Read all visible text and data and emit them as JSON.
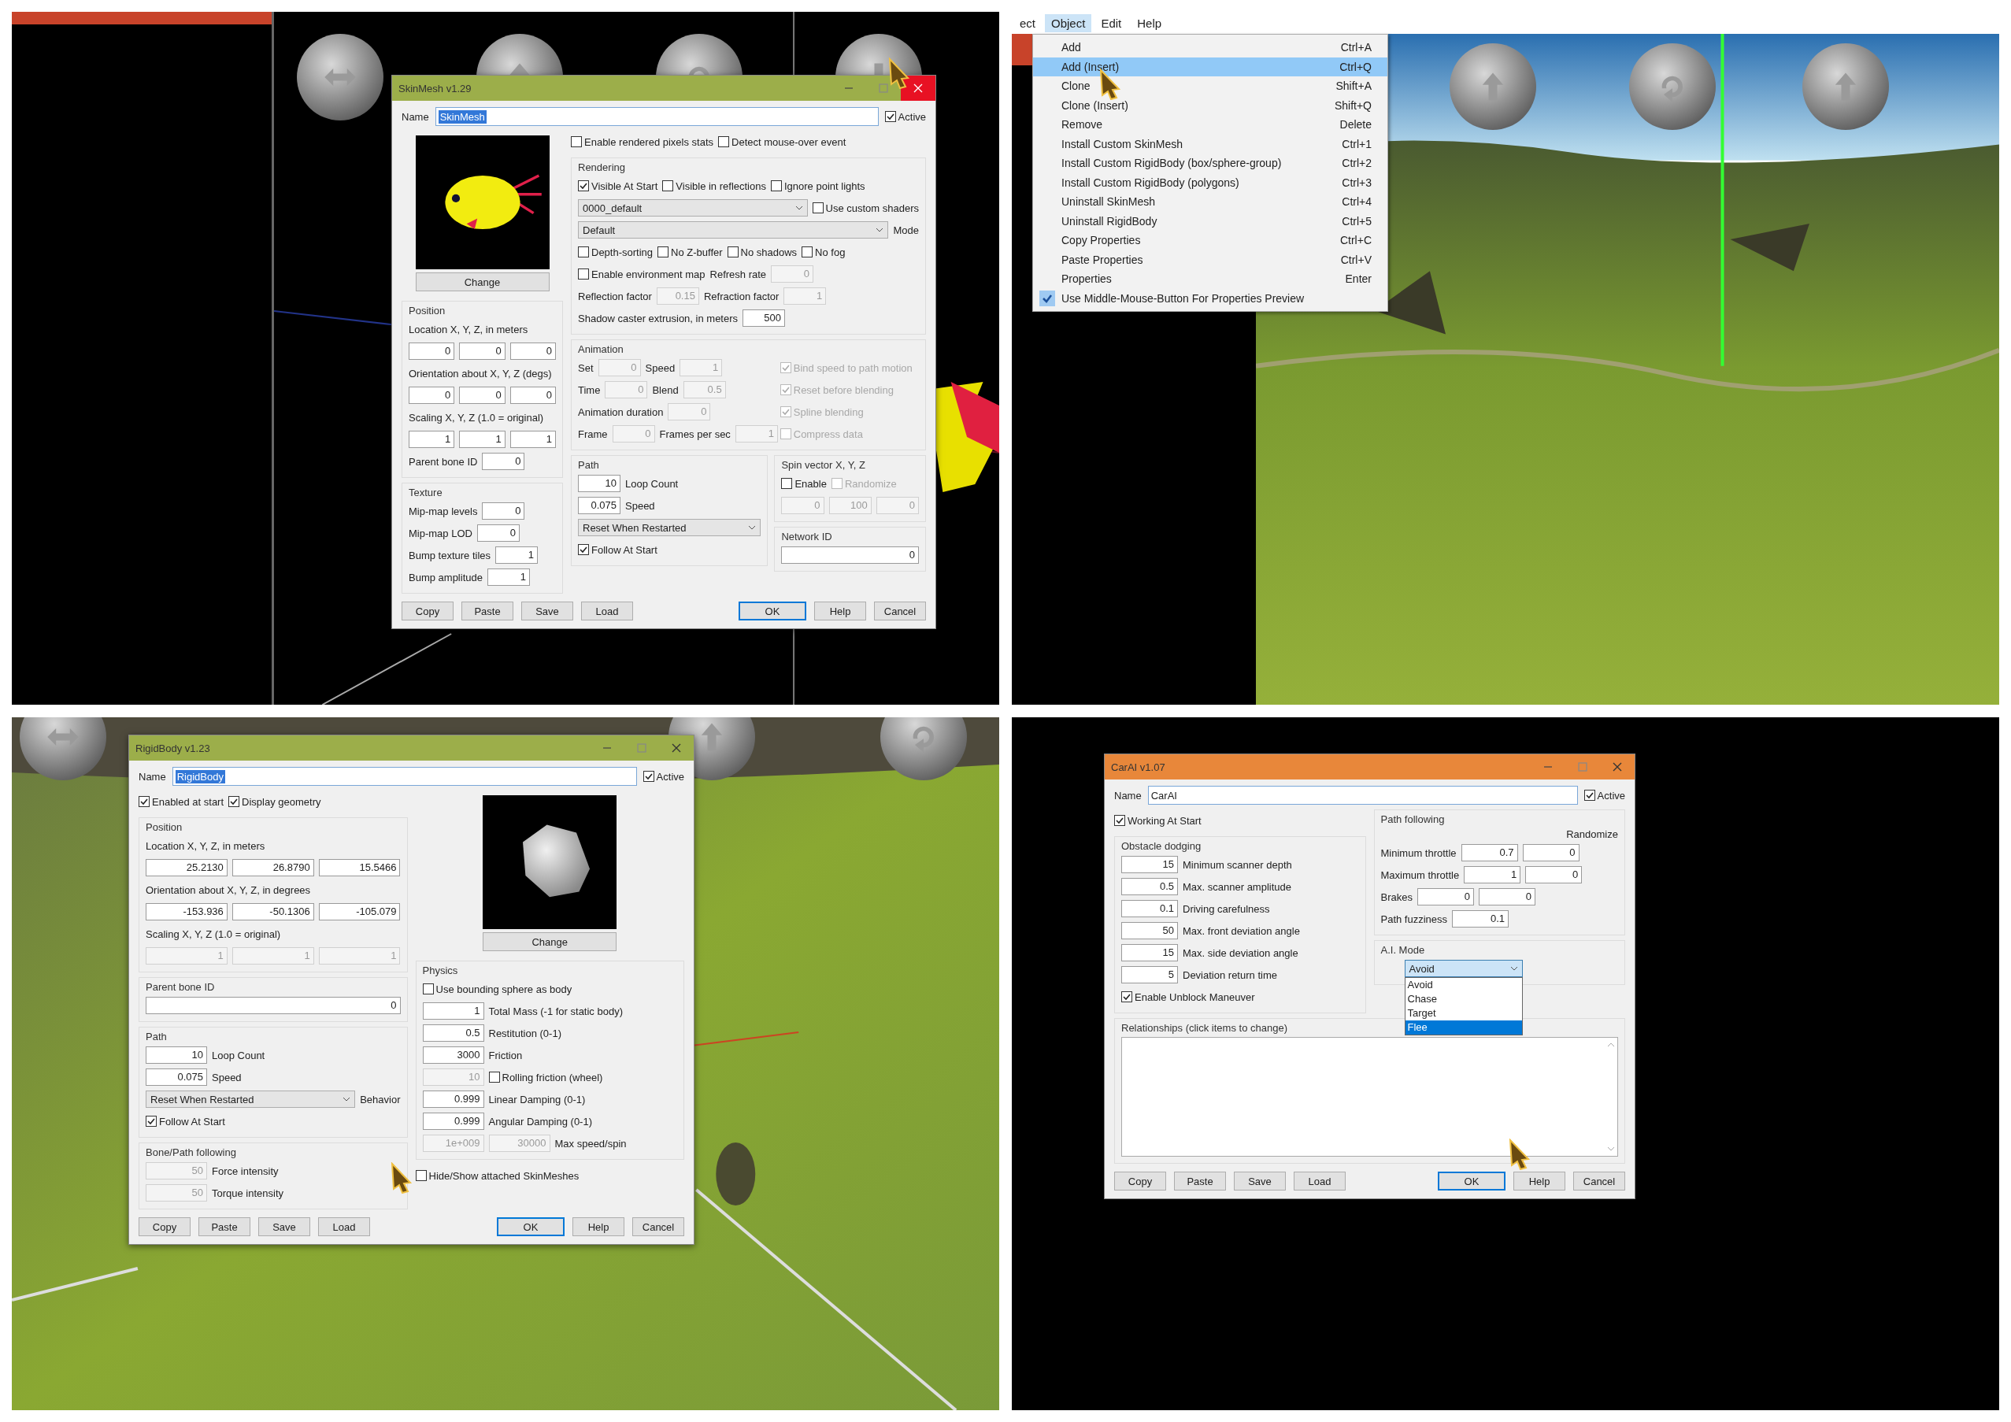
{
  "panels": [
    {
      "kind": "viewport",
      "spheres": [
        {
          "kind": "left-right"
        },
        {
          "kind": "up"
        },
        {
          "kind": "rotate"
        },
        {
          "kind": "down"
        }
      ],
      "dialog": {
        "title": "SkinMesh v1.29",
        "color": "#9cae4a",
        "close_hovered": true,
        "name_label": "Name",
        "name": "SkinMesh",
        "name_selected": true,
        "active": {
          "label": "Active",
          "checked": true
        },
        "body": [
          {
            "columns": [
              [
                {
                  "kind": "creature-preview",
                  "button": "Change"
                },
                {
                  "kind": "group",
                  "title": "Position",
                  "rows": [
                    [
                      {
                        "kind": "text",
                        "label": "Location X, Y, Z, in meters"
                      }
                    ],
                    [
                      {
                        "kind": "field",
                        "value": "0",
                        "disabled": false
                      },
                      {
                        "kind": "field",
                        "value": "0",
                        "disabled": false
                      },
                      {
                        "kind": "field",
                        "value": "0",
                        "disabled": false
                      }
                    ],
                    [
                      {
                        "kind": "text",
                        "label": "Orientation about X, Y, Z (degs)"
                      }
                    ],
                    [
                      {
                        "kind": "field",
                        "value": "0",
                        "disabled": false
                      },
                      {
                        "kind": "field",
                        "value": "0",
                        "disabled": false
                      },
                      {
                        "kind": "field",
                        "value": "0",
                        "disabled": false
                      }
                    ],
                    [
                      {
                        "kind": "text",
                        "label": "Scaling X, Y, Z (1.0 = original)"
                      }
                    ],
                    [
                      {
                        "kind": "field",
                        "value": "1",
                        "disabled": false
                      },
                      {
                        "kind": "field",
                        "value": "1",
                        "disabled": false
                      },
                      {
                        "kind": "field",
                        "value": "1",
                        "disabled": false
                      }
                    ],
                    [
                      {
                        "kind": "text",
                        "label": "Parent bone ID"
                      },
                      {
                        "kind": "field",
                        "value": "0",
                        "disabled": false
                      }
                    ]
                  ]
                },
                {
                  "kind": "group",
                  "title": "Texture",
                  "rows": [
                    [
                      {
                        "kind": "text",
                        "label": "Mip-map levels"
                      },
                      {
                        "kind": "field",
                        "value": "0",
                        "disabled": false
                      }
                    ],
                    [
                      {
                        "kind": "text",
                        "label": "Mip-map LOD"
                      },
                      {
                        "kind": "field",
                        "value": "0",
                        "disabled": false
                      }
                    ],
                    [
                      {
                        "kind": "text",
                        "label": "Bump texture tiles"
                      },
                      {
                        "kind": "field",
                        "value": "1",
                        "disabled": false
                      }
                    ],
                    [
                      {
                        "kind": "text",
                        "label": "Bump amplitude"
                      },
                      {
                        "kind": "field",
                        "value": "1",
                        "disabled": false
                      }
                    ]
                  ]
                }
              ],
              [
                {
                  "kind": "plain",
                  "rows": [
                    [
                      {
                        "kind": "check",
                        "label": "Enable rendered pixels stats",
                        "checked": false,
                        "disabled": false
                      },
                      {
                        "kind": "check",
                        "label": "Detect mouse-over event",
                        "checked": false,
                        "disabled": false
                      }
                    ]
                  ]
                },
                {
                  "kind": "group",
                  "title": "Rendering",
                  "rows": [
                    [
                      {
                        "kind": "check",
                        "label": "Visible At Start",
                        "checked": true,
                        "disabled": false
                      },
                      {
                        "kind": "check",
                        "label": "Visible in reflections",
                        "checked": false,
                        "disabled": false
                      },
                      {
                        "kind": "check",
                        "label": "Ignore point lights",
                        "checked": false,
                        "disabled": false
                      }
                    ],
                    [
                      {
                        "kind": "select",
                        "value": "0000_default"
                      },
                      {
                        "kind": "check",
                        "label": "Use custom shaders",
                        "checked": false,
                        "disabled": false
                      }
                    ],
                    [
                      {
                        "kind": "select",
                        "value": "Default"
                      },
                      {
                        "kind": "text",
                        "label": "Mode"
                      }
                    ],
                    [
                      {
                        "kind": "check",
                        "label": "Depth-sorting",
                        "checked": false,
                        "disabled": false
                      },
                      {
                        "kind": "check",
                        "label": "No Z-buffer",
                        "checked": false,
                        "disabled": false
                      },
                      {
                        "kind": "check",
                        "label": "No shadows",
                        "checked": false,
                        "disabled": false
                      },
                      {
                        "kind": "check",
                        "label": "No fog",
                        "checked": false,
                        "disabled": false
                      }
                    ],
                    [
                      {
                        "kind": "check",
                        "label": "Enable environment map",
                        "checked": false,
                        "disabled": false
                      },
                      {
                        "kind": "text",
                        "label": "Refresh rate"
                      },
                      {
                        "kind": "field",
                        "value": "0",
                        "disabled": true
                      }
                    ],
                    [
                      {
                        "kind": "text",
                        "label": "Reflection factor"
                      },
                      {
                        "kind": "field",
                        "value": "0.15",
                        "disabled": true
                      },
                      {
                        "kind": "text",
                        "label": "Refraction factor"
                      },
                      {
                        "kind": "field",
                        "value": "1",
                        "disabled": true
                      }
                    ],
                    [
                      {
                        "kind": "text",
                        "label": "Shadow caster extrusion, in meters"
                      },
                      {
                        "kind": "field",
                        "value": "500",
                        "disabled": false
                      }
                    ]
                  ]
                },
                {
                  "kind": "group",
                  "title": "Animation",
                  "rows": [
                    [
                      {
                        "kind": "text",
                        "label": "Set"
                      },
                      {
                        "kind": "field",
                        "value": "0",
                        "disabled": true
                      },
                      {
                        "kind": "text",
                        "label": "Speed"
                      },
                      {
                        "kind": "field",
                        "value": "1",
                        "disabled": true
                      }
                    ],
                    [
                      {
                        "kind": "text",
                        "label": "Time"
                      },
                      {
                        "kind": "field",
                        "value": "0",
                        "disabled": true
                      },
                      {
                        "kind": "text",
                        "label": "Blend"
                      },
                      {
                        "kind": "field",
                        "value": "0.5",
                        "disabled": true
                      }
                    ],
                    [
                      {
                        "kind": "text",
                        "label": "Animation duration"
                      },
                      {
                        "kind": "field",
                        "value": "0",
                        "disabled": true
                      }
                    ],
                    [
                      {
                        "kind": "text",
                        "label": "Frame"
                      },
                      {
                        "kind": "field",
                        "value": "0",
                        "disabled": true
                      },
                      {
                        "kind": "text",
                        "label": "Frames per sec"
                      },
                      {
                        "kind": "field",
                        "value": "1",
                        "disabled": true
                      }
                    ]
                  ],
                  "aside": [
                    [
                      {
                        "kind": "check",
                        "label": "Bind speed to path motion",
                        "checked": true,
                        "disabled": true
                      }
                    ],
                    [
                      {
                        "kind": "check",
                        "label": "Reset before blending",
                        "checked": true,
                        "disabled": true
                      }
                    ],
                    [
                      {
                        "kind": "check",
                        "label": "Spline blending",
                        "checked": true,
                        "disabled": true
                      }
                    ],
                    [
                      {
                        "kind": "check",
                        "label": "Compress data",
                        "checked": false,
                        "disabled": true
                      }
                    ]
                  ]
                },
                {
                  "kind": "pair",
                  "stacks": [
                    [
                      {
                        "kind": "group",
                        "title": "Path",
                        "rows": [
                          [
                            {
                              "kind": "field",
                              "value": "10",
                              "disabled": false
                            },
                            {
                              "kind": "text",
                              "label": "Loop Count"
                            }
                          ],
                          [
                            {
                              "kind": "field",
                              "value": "0.075",
                              "disabled": false
                            },
                            {
                              "kind": "text",
                              "label": "Speed"
                            }
                          ],
                          [
                            {
                              "kind": "select",
                              "value": "Reset When Restarted"
                            }
                          ],
                          [
                            {
                              "kind": "check",
                              "label": "Follow At Start",
                              "checked": true,
                              "disabled": false
                            }
                          ]
                        ]
                      }
                    ],
                    [
                      {
                        "kind": "group",
                        "title": "Spin vector X, Y, Z",
                        "rows": [
                          [
                            {
                              "kind": "check",
                              "label": "Enable",
                              "checked": false,
                              "disabled": false
                            },
                            {
                              "kind": "check",
                              "label": "Randomize",
                              "checked": false,
                              "disabled": true
                            }
                          ],
                          [
                            {
                              "kind": "field",
                              "value": "0",
                              "disabled": true
                            },
                            {
                              "kind": "field",
                              "value": "100",
                              "disabled": true
                            },
                            {
                              "kind": "field",
                              "value": "0",
                              "disabled": true
                            }
                          ]
                        ]
                      },
                      {
                        "kind": "group",
                        "title": "Network ID",
                        "rows": [
                          [
                            {
                              "kind": "field",
                              "value": "0",
                              "disabled": false
                            }
                          ]
                        ]
                      }
                    ]
                  ]
                }
              ]
            ]
          }
        ],
        "buttons": [
          {
            "label": "Copy",
            "default": false
          },
          {
            "label": "Paste",
            "default": false
          },
          {
            "label": "Save",
            "default": false
          },
          {
            "label": "Load",
            "default": false
          },
          {
            "label": "OK",
            "default": true
          },
          {
            "label": "Help",
            "default": false
          },
          {
            "label": "Cancel",
            "default": false
          }
        ]
      }
    },
    {
      "kind": "menu",
      "spheres": [
        {
          "kind": "up"
        },
        {
          "kind": "rotate"
        },
        {
          "kind": "up"
        }
      ],
      "menubar": [
        {
          "label": "ect",
          "selected": false
        },
        {
          "label": "Object",
          "selected": true
        },
        {
          "label": "Edit",
          "selected": false
        },
        {
          "label": "Help",
          "selected": false
        }
      ],
      "menu": [
        {
          "label": "Add",
          "shortcut": "Ctrl+A",
          "highlighted": false,
          "checked": false
        },
        {
          "label": "Add (Insert)",
          "shortcut": "Ctrl+Q",
          "highlighted": true,
          "checked": false
        },
        {
          "label": "Clone",
          "shortcut": "Shift+A",
          "highlighted": false,
          "checked": false
        },
        {
          "label": "Clone (Insert)",
          "shortcut": "Shift+Q",
          "highlighted": false,
          "checked": false
        },
        {
          "label": "Remove",
          "shortcut": "Delete",
          "highlighted": false,
          "checked": false
        },
        {
          "label": "Install Custom SkinMesh",
          "shortcut": "Ctrl+1",
          "highlighted": false,
          "checked": false
        },
        {
          "label": "Install Custom RigidBody (box/sphere-group)",
          "shortcut": "Ctrl+2",
          "highlighted": false,
          "checked": false
        },
        {
          "label": "Install Custom RigidBody (polygons)",
          "shortcut": "Ctrl+3",
          "highlighted": false,
          "checked": false
        },
        {
          "label": "Uninstall SkinMesh",
          "shortcut": "Ctrl+4",
          "highlighted": false,
          "checked": false
        },
        {
          "label": "Uninstall RigidBody",
          "shortcut": "Ctrl+5",
          "highlighted": false,
          "checked": false
        },
        {
          "label": "Copy Properties",
          "shortcut": "Ctrl+C",
          "highlighted": false,
          "checked": false
        },
        {
          "label": "Paste Properties",
          "shortcut": "Ctrl+V",
          "highlighted": false,
          "checked": false
        },
        {
          "label": "Properties",
          "shortcut": "Enter",
          "highlighted": false,
          "checked": false
        },
        {
          "label": "Use Middle-Mouse-Button For Properties Preview",
          "highlighted": false,
          "checked": true
        }
      ]
    },
    {
      "kind": "terrain",
      "spheres": [
        {
          "kind": "left-right"
        },
        {
          "kind": "up"
        },
        {
          "kind": "rotate"
        }
      ],
      "dialog": {
        "title": "RigidBody v1.23",
        "color": "#9cae4a",
        "close_hovered": false,
        "name_label": "Name",
        "name": "RigidBody",
        "name_selected": true,
        "active": {
          "label": "Active",
          "checked": true
        },
        "body": [
          {
            "columns": [
              [
                {
                  "kind": "plain",
                  "rows": [
                    [
                      {
                        "kind": "check",
                        "label": "Enabled at start",
                        "checked": true,
                        "disabled": false
                      },
                      {
                        "kind": "check",
                        "label": "Display geometry",
                        "checked": true,
                        "disabled": false
                      }
                    ]
                  ]
                },
                {
                  "kind": "group",
                  "title": "Position",
                  "rows": [
                    [
                      {
                        "kind": "text",
                        "label": "Location X, Y, Z, in meters"
                      }
                    ],
                    [
                      {
                        "kind": "field",
                        "value": "25.2130",
                        "disabled": false
                      },
                      {
                        "kind": "field",
                        "value": "26.8790",
                        "disabled": false
                      },
                      {
                        "kind": "field",
                        "value": "15.5466",
                        "disabled": false
                      }
                    ],
                    [
                      {
                        "kind": "text",
                        "label": "Orientation about X, Y, Z, in degrees"
                      }
                    ],
                    [
                      {
                        "kind": "field",
                        "value": "-153.936",
                        "disabled": false
                      },
                      {
                        "kind": "field",
                        "value": "-50.1306",
                        "disabled": false
                      },
                      {
                        "kind": "field",
                        "value": "-105.079",
                        "disabled": false
                      }
                    ],
                    [
                      {
                        "kind": "text",
                        "label": "Scaling X, Y, Z (1.0 = original)"
                      }
                    ],
                    [
                      {
                        "kind": "field",
                        "value": "1",
                        "disabled": true
                      },
                      {
                        "kind": "field",
                        "value": "1",
                        "disabled": true
                      },
                      {
                        "kind": "field",
                        "value": "1",
                        "disabled": true
                      }
                    ]
                  ]
                },
                {
                  "kind": "group",
                  "title": "Parent bone ID",
                  "rows": [
                    [
                      {
                        "kind": "field",
                        "value": "0",
                        "disabled": false
                      }
                    ]
                  ]
                },
                {
                  "kind": "group",
                  "title": "Path",
                  "rows": [
                    [
                      {
                        "kind": "field",
                        "value": "10",
                        "disabled": false
                      },
                      {
                        "kind": "text",
                        "label": "Loop Count"
                      }
                    ],
                    [
                      {
                        "kind": "field",
                        "value": "0.075",
                        "disabled": false
                      },
                      {
                        "kind": "text",
                        "label": "Speed"
                      }
                    ],
                    [
                      {
                        "kind": "select",
                        "value": "Reset When Restarted"
                      },
                      {
                        "kind": "text",
                        "label": "Behavior"
                      }
                    ],
                    [
                      {
                        "kind": "check",
                        "label": "Follow At Start",
                        "checked": true,
                        "disabled": false
                      }
                    ]
                  ]
                },
                {
                  "kind": "group",
                  "title": "Bone/Path following",
                  "rows": [
                    [
                      {
                        "kind": "field",
                        "value": "50",
                        "disabled": true
                      },
                      {
                        "kind": "text",
                        "label": "Force intensity"
                      }
                    ],
                    [
                      {
                        "kind": "field",
                        "value": "50",
                        "disabled": true
                      },
                      {
                        "kind": "text",
                        "label": "Torque intensity"
                      }
                    ]
                  ]
                }
              ],
              [
                {
                  "kind": "rock-preview",
                  "button": "Change"
                },
                {
                  "kind": "group",
                  "title": "Physics",
                  "rows": [
                    [
                      {
                        "kind": "check",
                        "label": "Use bounding sphere as body",
                        "checked": false,
                        "disabled": false
                      }
                    ],
                    [
                      {
                        "kind": "field",
                        "value": "1",
                        "disabled": false
                      },
                      {
                        "kind": "text",
                        "label": "Total Mass (-1 for static body)"
                      }
                    ],
                    [
                      {
                        "kind": "field",
                        "value": "0.5",
                        "disabled": false
                      },
                      {
                        "kind": "text",
                        "label": "Restitution (0-1)"
                      }
                    ],
                    [
                      {
                        "kind": "field",
                        "value": "3000",
                        "disabled": false
                      },
                      {
                        "kind": "text",
                        "label": "Friction"
                      }
                    ],
                    [
                      {
                        "kind": "field",
                        "value": "10",
                        "disabled": true
                      },
                      {
                        "kind": "check",
                        "label": "Rolling friction (wheel)",
                        "checked": false,
                        "disabled": false
                      }
                    ],
                    [
                      {
                        "kind": "field",
                        "value": "0.999",
                        "disabled": false
                      },
                      {
                        "kind": "text",
                        "label": "Linear Damping (0-1)"
                      }
                    ],
                    [
                      {
                        "kind": "field",
                        "value": "0.999",
                        "disabled": false
                      },
                      {
                        "kind": "text",
                        "label": "Angular Damping (0-1)"
                      }
                    ],
                    [
                      {
                        "kind": "field",
                        "value": "1e+009",
                        "disabled": true
                      },
                      {
                        "kind": "field",
                        "value": "30000",
                        "disabled": true
                      },
                      {
                        "kind": "text",
                        "label": "Max speed/spin"
                      }
                    ]
                  ]
                },
                {
                  "kind": "plain",
                  "rows": [
                    [
                      {
                        "kind": "check",
                        "label": "Hide/Show attached SkinMeshes",
                        "checked": false,
                        "disabled": false
                      }
                    ]
                  ]
                }
              ]
            ]
          }
        ],
        "buttons": [
          {
            "label": "Copy",
            "default": false
          },
          {
            "label": "Paste",
            "default": false
          },
          {
            "label": "Save",
            "default": false
          },
          {
            "label": "Load",
            "default": false
          },
          {
            "label": "OK",
            "default": true
          },
          {
            "label": "Help",
            "default": false
          },
          {
            "label": "Cancel",
            "default": false
          }
        ]
      }
    },
    {
      "kind": "dark",
      "dialog": {
        "title": "CarAI v1.07",
        "color": "#e8873a",
        "close_hovered": false,
        "name_label": "Name",
        "name": "CarAI",
        "name_selected": false,
        "active": {
          "label": "Active",
          "checked": true
        },
        "body": [
          {
            "columns": [
              [
                {
                  "kind": "plain",
                  "rows": [
                    [
                      {
                        "kind": "check",
                        "label": "Working At Start",
                        "checked": true,
                        "disabled": false
                      }
                    ]
                  ]
                },
                {
                  "kind": "group",
                  "title": "Obstacle dodging",
                  "rows": [
                    [
                      {
                        "kind": "field",
                        "value": "15",
                        "disabled": false
                      },
                      {
                        "kind": "text",
                        "label": "Minimum scanner depth"
                      }
                    ],
                    [
                      {
                        "kind": "field",
                        "value": "0.5",
                        "disabled": false
                      },
                      {
                        "kind": "text",
                        "label": "Max. scanner amplitude"
                      }
                    ],
                    [
                      {
                        "kind": "field",
                        "value": "0.1",
                        "disabled": false
                      },
                      {
                        "kind": "text",
                        "label": "Driving carefulness"
                      }
                    ],
                    [
                      {
                        "kind": "field",
                        "value": "50",
                        "disabled": false
                      },
                      {
                        "kind": "text",
                        "label": "Max. front deviation angle"
                      }
                    ],
                    [
                      {
                        "kind": "field",
                        "value": "15",
                        "disabled": false
                      },
                      {
                        "kind": "text",
                        "label": "Max. side deviation angle"
                      }
                    ],
                    [
                      {
                        "kind": "field",
                        "value": "5",
                        "disabled": false
                      },
                      {
                        "kind": "text",
                        "label": "Deviation return time"
                      }
                    ],
                    [
                      {
                        "kind": "check",
                        "label": "Enable Unblock Maneuver",
                        "checked": true,
                        "disabled": false
                      }
                    ]
                  ]
                }
              ],
              [
                {
                  "kind": "group",
                  "title": "Path following",
                  "heading": "Randomize",
                  "rows": [
                    [
                      {
                        "kind": "text",
                        "label": "Minimum throttle"
                      },
                      {
                        "kind": "field",
                        "value": "0.7",
                        "disabled": false
                      },
                      {
                        "kind": "field",
                        "value": "0",
                        "disabled": false
                      }
                    ],
                    [
                      {
                        "kind": "text",
                        "label": "Maximum throttle"
                      },
                      {
                        "kind": "field",
                        "value": "1",
                        "disabled": false
                      },
                      {
                        "kind": "field",
                        "value": "0",
                        "disabled": false
                      }
                    ],
                    [
                      {
                        "kind": "text",
                        "label": "Brakes"
                      },
                      {
                        "kind": "field",
                        "value": "0",
                        "disabled": false
                      },
                      {
                        "kind": "field",
                        "value": "0",
                        "disabled": false
                      }
                    ],
                    [
                      {
                        "kind": "text",
                        "label": "Path fuzziness"
                      },
                      {
                        "kind": "field",
                        "value": "0.1",
                        "disabled": false
                      }
                    ]
                  ]
                },
                {
                  "kind": "group",
                  "title": "A.I. Mode",
                  "rows": [
                    [
                      {
                        "kind": "dropdown",
                        "value": "Avoid",
                        "options": [
                          {
                            "label": "Avoid",
                            "highlighted": false
                          },
                          {
                            "label": "Chase",
                            "highlighted": false
                          },
                          {
                            "label": "Target",
                            "highlighted": false
                          },
                          {
                            "label": "Flee",
                            "highlighted": true
                          }
                        ]
                      }
                    ]
                  ]
                }
              ]
            ]
          },
          {
            "columns": [
              [
                {
                  "kind": "group",
                  "title": "Relationships (click items to change)",
                  "rows": [
                    [
                      {
                        "kind": "listbox"
                      }
                    ]
                  ]
                }
              ]
            ]
          }
        ],
        "buttons": [
          {
            "label": "Copy",
            "default": false
          },
          {
            "label": "Paste",
            "default": false
          },
          {
            "label": "Save",
            "default": false
          },
          {
            "label": "Load",
            "default": false
          },
          {
            "label": "OK",
            "default": true
          },
          {
            "label": "Help",
            "default": false
          },
          {
            "label": "Cancel",
            "default": false
          }
        ]
      }
    }
  ]
}
